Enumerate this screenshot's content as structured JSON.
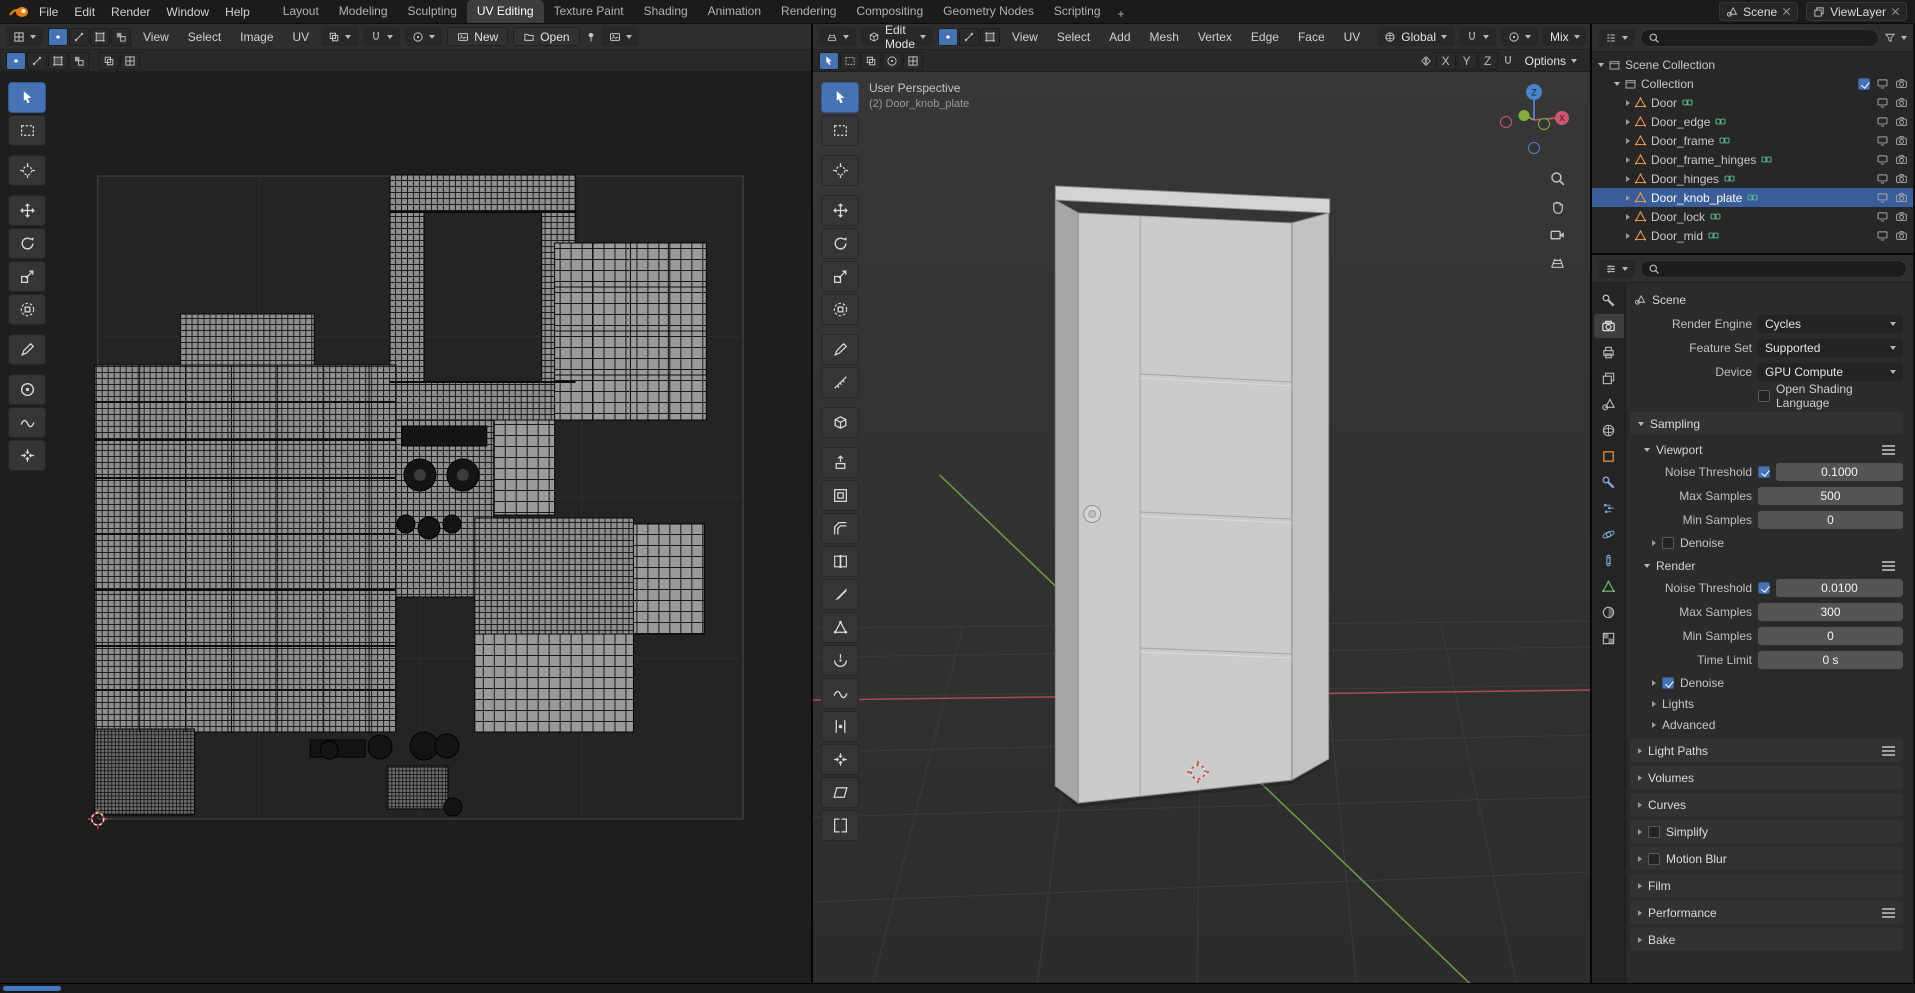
{
  "topbar": {
    "menus": [
      "File",
      "Edit",
      "Render",
      "Window",
      "Help"
    ],
    "workspaces": [
      "Layout",
      "Modeling",
      "Sculpting",
      "UV Editing",
      "Texture Paint",
      "Shading",
      "Animation",
      "Rendering",
      "Compositing",
      "Geometry Nodes",
      "Scripting"
    ],
    "active_workspace": "UV Editing",
    "add_workspace": "+",
    "scene_name": "Scene",
    "viewlayer_name": "ViewLayer"
  },
  "uv_editor": {
    "menus": [
      "View",
      "Select",
      "Image",
      "UV"
    ],
    "new_label": "New",
    "open_label": "Open",
    "tools": [
      "tweak",
      "select-box",
      "cursor",
      "move",
      "rotate",
      "scale",
      "transform",
      "annotate",
      "grab",
      "relax",
      "pinch"
    ]
  },
  "viewport": {
    "mode": "Edit Mode",
    "menus": [
      "View",
      "Select",
      "Add",
      "Mesh",
      "Vertex",
      "Edge",
      "Face",
      "UV"
    ],
    "orientation": "Global",
    "blend": "Mix",
    "options_label": "Options",
    "mirror": [
      "X",
      "Y",
      "Z"
    ],
    "overlay": {
      "line1": "User Perspective",
      "line2": "(2) Door_knob_plate"
    },
    "gizmo": {
      "z": "Z",
      "x": "X"
    },
    "tools": [
      "tweak",
      "select-box",
      "cursor",
      "move",
      "rotate",
      "scale",
      "transform",
      "annotate",
      "measure",
      "add-cube",
      "extrude-region",
      "inset-faces",
      "bevel",
      "loop-cut",
      "knife",
      "poly-build",
      "spin",
      "smooth",
      "edge-slide",
      "shrink-fatten",
      "shear",
      "rip-region"
    ]
  },
  "outliner": {
    "scene_collection": "Scene Collection",
    "collection": "Collection",
    "objects": [
      "Door",
      "Door_edge",
      "Door_frame",
      "Door_frame_hinges",
      "Door_hinges",
      "Door_knob_plate",
      "Door_lock",
      "Door_mid"
    ],
    "selected_object": "Door_knob_plate"
  },
  "properties": {
    "breadcrumb": "Scene",
    "tabs": [
      "tool",
      "render",
      "output",
      "view-layer",
      "scene",
      "world",
      "object",
      "modifiers",
      "particles",
      "physics",
      "constraints",
      "object-data",
      "material",
      "texture"
    ],
    "active_tab": "render",
    "render_engine": {
      "label": "Render Engine",
      "value": "Cycles"
    },
    "feature_set": {
      "label": "Feature Set",
      "value": "Supported"
    },
    "device": {
      "label": "Device",
      "value": "GPU Compute"
    },
    "osl_label": "Open Shading Language",
    "sampling": {
      "title": "Sampling",
      "viewport": {
        "title": "Viewport",
        "noise": {
          "label": "Noise Threshold",
          "value": "0.1000"
        },
        "max": {
          "label": "Max Samples",
          "value": "500"
        },
        "min": {
          "label": "Min Samples",
          "value": "0"
        },
        "denoise_label": "Denoise"
      },
      "render": {
        "title": "Render",
        "noise": {
          "label": "Noise Threshold",
          "value": "0.0100"
        },
        "max": {
          "label": "Max Samples",
          "value": "300"
        },
        "min": {
          "label": "Min Samples",
          "value": "0"
        },
        "time": {
          "label": "Time Limit",
          "value": "0 s"
        },
        "denoise_label": "Denoise"
      },
      "lights_label": "Lights",
      "advanced_label": "Advanced"
    },
    "sections": [
      "Light Paths",
      "Volumes",
      "Curves",
      "Simplify",
      "Motion Blur",
      "Film",
      "Performance",
      "Bake"
    ]
  },
  "colors": {
    "accent": "#4772b3",
    "selected_row": "#3a5c99",
    "mesh_icon": "#ff9e4a",
    "axis_x": "#b04a4a",
    "axis_y": "#6d9e45",
    "axis_z": "#4a8fe0"
  }
}
